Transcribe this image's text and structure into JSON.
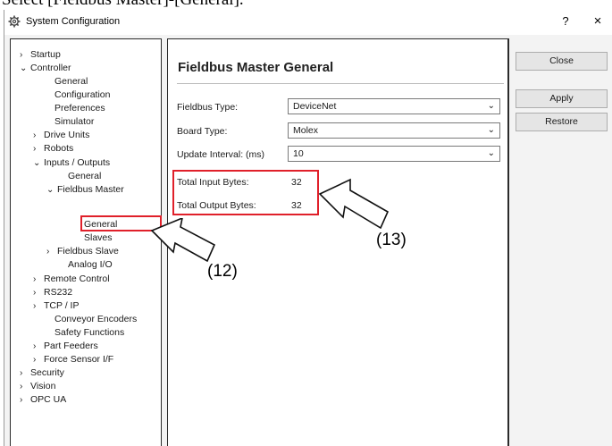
{
  "caption": "Select [Fieldbus Master]-[General].",
  "window": {
    "title": "System Configuration",
    "help_label": "?",
    "close_label": "×"
  },
  "tree": [
    {
      "label": "Startup",
      "chevron": "›"
    },
    {
      "label": "Controller",
      "chevron": "⌄"
    },
    {
      "label": "General",
      "chevron": ""
    },
    {
      "label": "Configuration",
      "chevron": ""
    },
    {
      "label": "Preferences",
      "chevron": ""
    },
    {
      "label": "Simulator",
      "chevron": ""
    },
    {
      "label": "Drive Units",
      "chevron": "›"
    },
    {
      "label": "Robots",
      "chevron": "›"
    },
    {
      "label": "Inputs / Outputs",
      "chevron": "⌄"
    },
    {
      "label": "General",
      "chevron": ""
    },
    {
      "label": "Fieldbus Master",
      "chevron": "⌄"
    },
    {
      "label": "General",
      "chevron": ""
    },
    {
      "label": "Slaves",
      "chevron": ""
    },
    {
      "label": "Fieldbus Slave",
      "chevron": "›"
    },
    {
      "label": "Analog I/O",
      "chevron": ""
    },
    {
      "label": "Remote Control",
      "chevron": "›"
    },
    {
      "label": "RS232",
      "chevron": "›"
    },
    {
      "label": "TCP / IP",
      "chevron": "›"
    },
    {
      "label": "Conveyor Encoders",
      "chevron": ""
    },
    {
      "label": "Safety Functions",
      "chevron": ""
    },
    {
      "label": "Part Feeders",
      "chevron": "›"
    },
    {
      "label": "Force Sensor I/F",
      "chevron": "›"
    },
    {
      "label": "Security",
      "chevron": "›"
    },
    {
      "label": "Vision",
      "chevron": "›"
    },
    {
      "label": "OPC UA",
      "chevron": "›"
    }
  ],
  "main": {
    "title": "Fieldbus Master General",
    "fieldbus_type_label": "Fieldbus Type:",
    "fieldbus_type_value": "DeviceNet",
    "board_type_label": "Board Type:",
    "board_type_value": "Molex",
    "update_interval_label": "Update Interval: (ms)",
    "update_interval_value": "10",
    "total_input_label": "Total Input Bytes:",
    "total_input_value": "32",
    "total_output_label": "Total Output Bytes:",
    "total_output_value": "32"
  },
  "buttons": {
    "close": "Close",
    "apply": "Apply",
    "restore": "Restore"
  },
  "callouts": {
    "c12": "(12)",
    "c13": "(13)"
  },
  "colors": {
    "highlight": "#e0202a"
  },
  "icons": {
    "title": "gear-icon",
    "dropdown": "chevron-down-icon",
    "tree_expand": "chevron-right-icon",
    "tree_collapse": "chevron-down-icon"
  }
}
